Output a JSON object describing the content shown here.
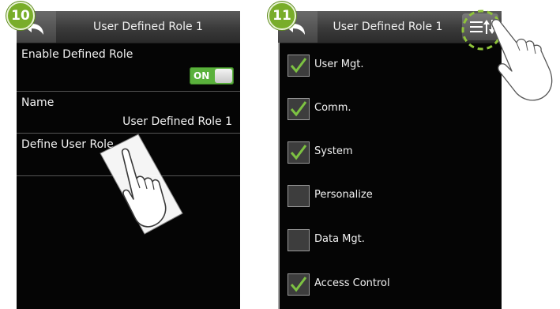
{
  "step10": {
    "badge": "10",
    "title": "User Defined Role 1",
    "rows": {
      "enable_label": "Enable Defined Role",
      "toggle_label": "ON",
      "name_label": "Name",
      "name_value": "User Defined Role 1",
      "define_label": "Define User Role"
    }
  },
  "step11": {
    "badge": "11",
    "title": "User Defined Role 1",
    "items": [
      {
        "label": "User Mgt.",
        "checked": true
      },
      {
        "label": "Comm.",
        "checked": true
      },
      {
        "label": "System",
        "checked": true
      },
      {
        "label": "Personalize",
        "checked": false
      },
      {
        "label": "Data Mgt.",
        "checked": false
      },
      {
        "label": "Access Control",
        "checked": true
      }
    ]
  },
  "colors": {
    "check_green": "#7dc242",
    "toggle_green": "#5ab13c",
    "badge_green": "#79ad2a",
    "highlight_dash": "#8fc43a"
  },
  "icons": [
    "back-arrow-icon",
    "sort-icon",
    "checkmark-icon",
    "pointing-hand-icon"
  ]
}
